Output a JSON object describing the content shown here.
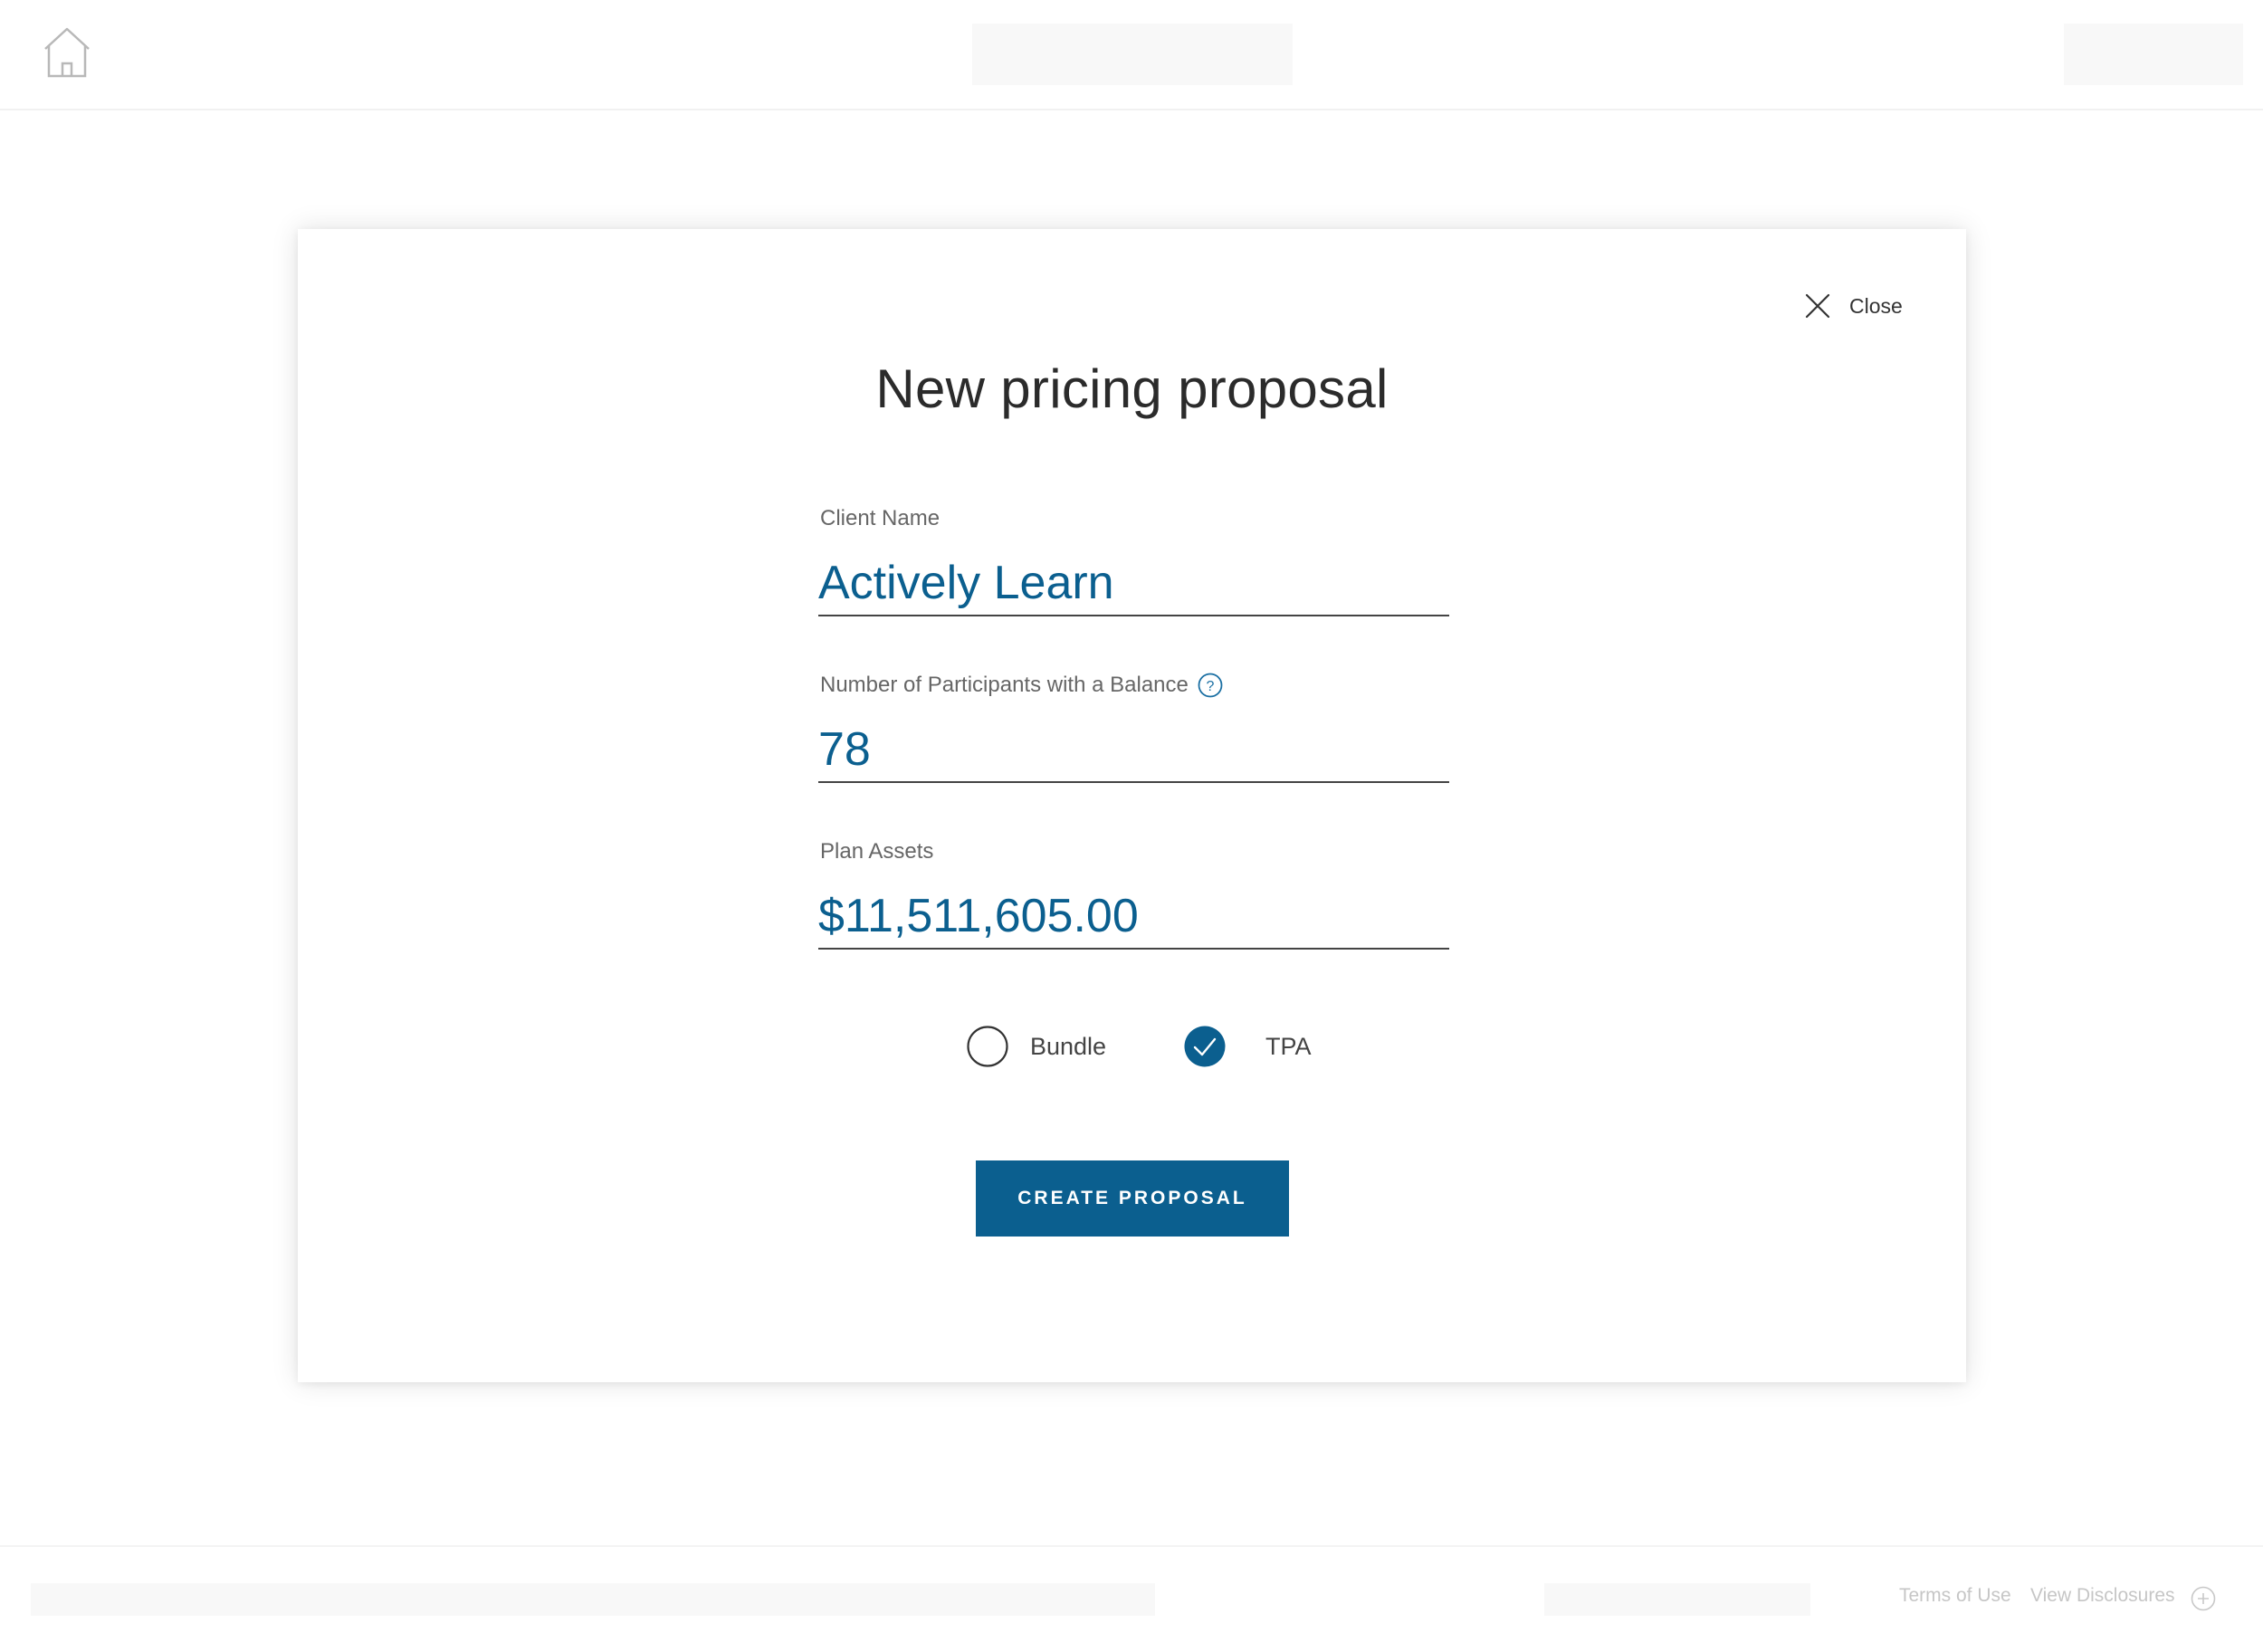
{
  "header": {
    "home_icon": "home-icon"
  },
  "modal": {
    "close_label": "Close",
    "close_icon": "close-icon",
    "title": "New pricing proposal",
    "fields": {
      "client_name": {
        "label": "Client Name",
        "value": "Actively Learn"
      },
      "participants": {
        "label": "Number of Participants with a Balance",
        "value": "78",
        "help_icon": "question-circle-icon"
      },
      "plan_assets": {
        "label": "Plan Assets",
        "value": "$11,511,605.00"
      }
    },
    "options": [
      {
        "label": "Bundle",
        "checked": false
      },
      {
        "label": "TPA",
        "checked": true
      }
    ],
    "create_button_label": "CREATE PROPOSAL"
  },
  "footer": {
    "terms_label": "Terms of Use",
    "disclosures_label": "View Disclosures",
    "plus_icon": "plus-circle-icon"
  },
  "colors": {
    "accent": "#0b5f8f",
    "text": "#333333",
    "muted": "#666666"
  }
}
